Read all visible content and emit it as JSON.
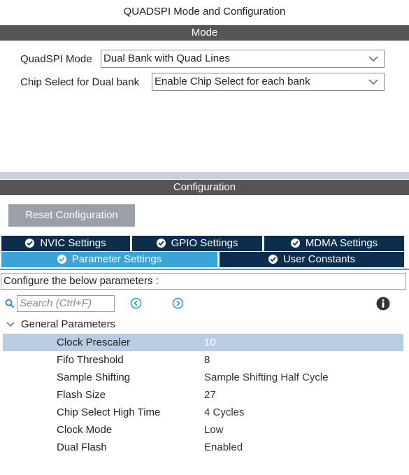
{
  "window": {
    "title": "QUADSPI Mode and Configuration"
  },
  "mode_section": {
    "header": "Mode",
    "quadspi_mode": {
      "label": "QuadSPI Mode",
      "value": "Dual Bank with Quad Lines"
    },
    "chip_select": {
      "label": "Chip Select for Dual bank",
      "value": "Enable Chip Select for each bank"
    }
  },
  "config_section": {
    "header": "Configuration",
    "reset_label": "Reset Configuration",
    "tabs_row1": [
      {
        "label": "NVIC Settings"
      },
      {
        "label": "GPIO Settings"
      },
      {
        "label": "MDMA Settings"
      }
    ],
    "tabs_row2": [
      {
        "label": "Parameter Settings",
        "active": true
      },
      {
        "label": "User Constants",
        "active": false
      }
    ],
    "hint": "Configure the below parameters :",
    "search_placeholder": "Search (Ctrl+F)",
    "group_label": "General Parameters",
    "params": [
      {
        "name": "Clock Prescaler",
        "value": "10"
      },
      {
        "name": "Fifo Threshold",
        "value": "8"
      },
      {
        "name": "Sample Shifting",
        "value": "Sample Shifting Half Cycle"
      },
      {
        "name": "Flash Size",
        "value": "27"
      },
      {
        "name": "Chip Select High Time",
        "value": "4 Cycles"
      },
      {
        "name": "Clock Mode",
        "value": "Low"
      },
      {
        "name": "Dual Flash",
        "value": "Enabled"
      }
    ]
  },
  "colors": {
    "header_bar": "#555558",
    "tab_dark": "#0c2d4e",
    "tab_active": "#3aa4d8",
    "selected_row": "#b8cde3"
  }
}
